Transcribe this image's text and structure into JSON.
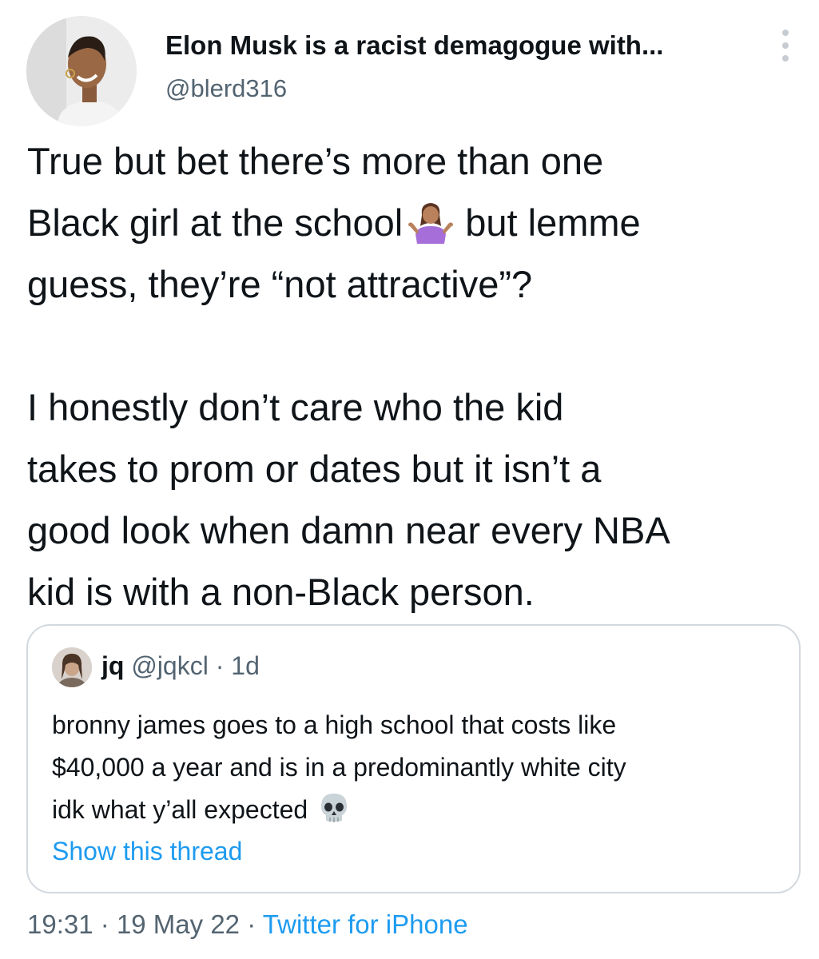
{
  "author": {
    "display_name": "Elon Musk is a racist demagogue with...",
    "handle": "@blerd316",
    "avatar_icon": "profile-photo"
  },
  "tweet": {
    "lines_p1": [
      "True but bet there’s more than one",
      "Black girl at the school",
      "but lemme",
      "guess, they’re “not attractive”?"
    ],
    "lines_p2": [
      "I honestly don’t care who the kid",
      "takes to prom or dates but it isn’t a",
      "good look when damn near every NBA",
      "kid is with a non-Black person."
    ],
    "emoji": "person-shrugging-medium-skin-tone"
  },
  "quote": {
    "name": "jq",
    "handle": "@jqkcl",
    "separator": "·",
    "age": "1d",
    "lines": [
      "bronny james goes to a high school that costs like",
      "$40,000 a year and is in a predominantly white city",
      "idk what y’all expected"
    ],
    "emoji": "skull",
    "show_thread": "Show this thread"
  },
  "footer": {
    "time": "19:31",
    "sep1": "·",
    "date": "19 May 22",
    "sep2": "·",
    "source": "Twitter for iPhone"
  },
  "colors": {
    "text": "#0f1419",
    "secondary": "#536471",
    "link": "#1d9bf0",
    "border": "#d3d9de"
  }
}
